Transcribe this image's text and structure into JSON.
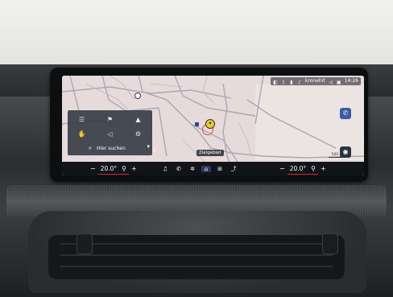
{
  "status_bar": {
    "station": "kronehit",
    "time": "14:26"
  },
  "panel": {
    "search_label": "Hier suchen"
  },
  "map": {
    "destination_label": "Zielgebiet",
    "scale_label": "500 m"
  },
  "climate": {
    "left_temp": "20.0°",
    "right_temp": "20.0°",
    "minus": "−",
    "plus": "+"
  },
  "colors": {
    "map_bg": "#e4d8d8",
    "accent_blue": "#3a5aa2",
    "red_line": "#e0202a"
  }
}
